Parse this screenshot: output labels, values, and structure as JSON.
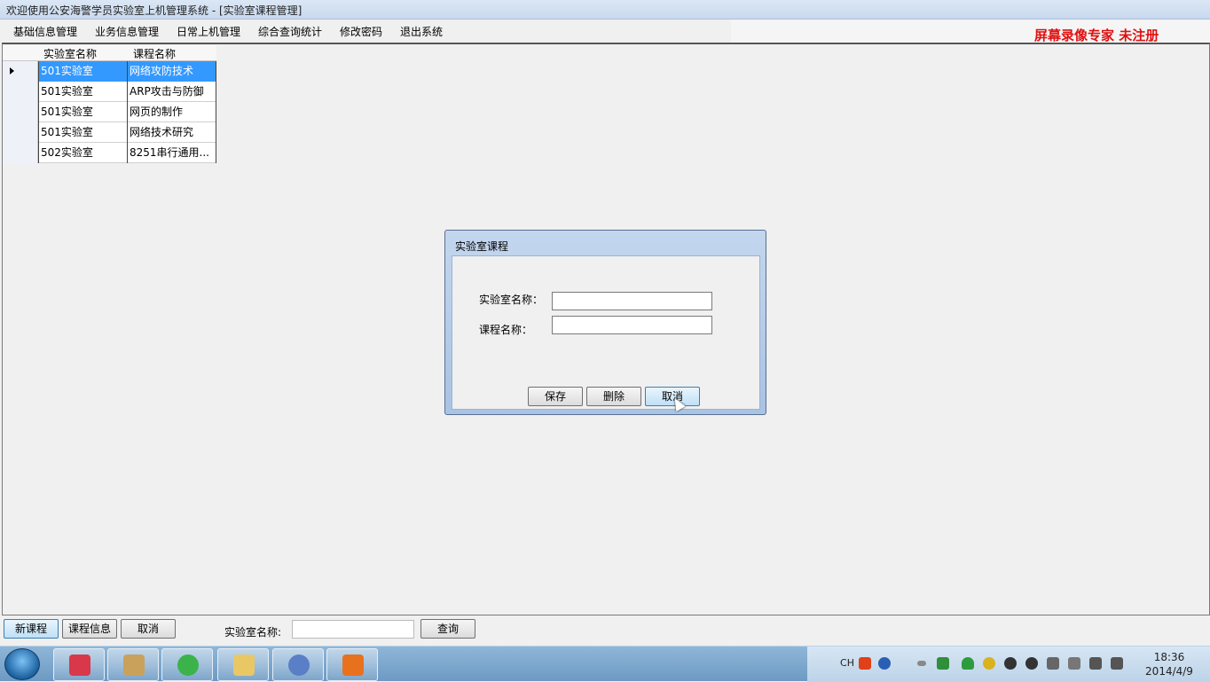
{
  "window": {
    "title": "欢迎使用公安海警学员实验室上机管理系统 - [实验室课程管理]"
  },
  "menu": [
    "基础信息管理",
    "业务信息管理",
    "日常上机管理",
    "综合查询统计",
    "修改密码",
    "退出系统"
  ],
  "watermark": "屏幕录像专家  未注册",
  "grid": {
    "columns": [
      "实验室名称",
      "课程名称"
    ],
    "rows": [
      [
        "501实验室",
        "网络攻防技术"
      ],
      [
        "501实验室",
        "ARP攻击与防御"
      ],
      [
        "501实验室",
        "网页的制作"
      ],
      [
        "501实验室",
        "网络技术研究"
      ],
      [
        "502实验室",
        "8251串行通用..."
      ]
    ],
    "selected_row": 0
  },
  "dialog": {
    "title": "实验室课程",
    "lab_label": "实验室名称：",
    "lab_value": "",
    "course_label": "课程名称：",
    "course_value": "",
    "save": "保存",
    "delete": "删除",
    "cancel": "取消"
  },
  "bottom": {
    "new_course": "新课程",
    "course_info": "课程信息",
    "cancel": "取消",
    "search_label": "实验室名称:",
    "search_value": "",
    "query": "查询"
  },
  "taskbar": {
    "ime": "CH",
    "time": "18:36",
    "date": "2014/4/9",
    "colors": {
      "accent": "#3399ff",
      "watermark": "#e01010"
    }
  }
}
